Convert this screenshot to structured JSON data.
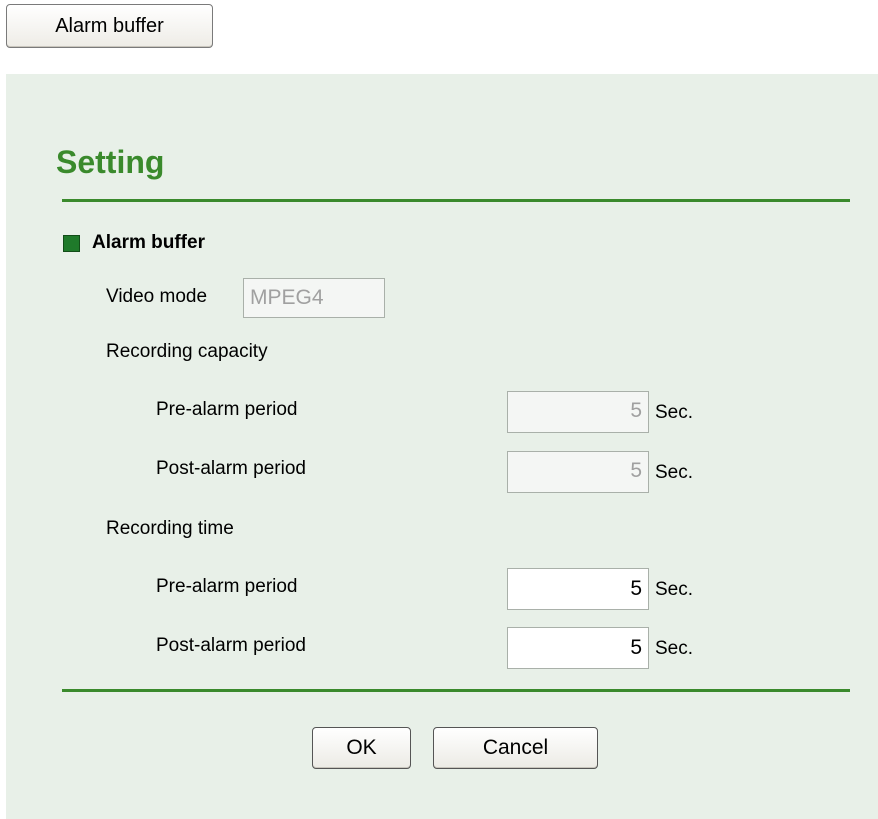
{
  "top_button": {
    "label": "Alarm buffer"
  },
  "page_title": "Setting",
  "section": {
    "label": "Alarm buffer",
    "video_mode": {
      "label": "Video mode",
      "value": "MPEG4"
    },
    "recording_capacity": {
      "label": "Recording capacity",
      "pre_alarm": {
        "label": "Pre-alarm period",
        "value": "5",
        "unit": "Sec."
      },
      "post_alarm": {
        "label": "Post-alarm period",
        "value": "5",
        "unit": "Sec."
      }
    },
    "recording_time": {
      "label": "Recording time",
      "pre_alarm": {
        "label": "Pre-alarm period",
        "value": "5",
        "unit": "Sec."
      },
      "post_alarm": {
        "label": "Post-alarm period",
        "value": "5",
        "unit": "Sec."
      }
    }
  },
  "buttons": {
    "ok": "OK",
    "cancel": "Cancel"
  },
  "colors": {
    "accent_green": "#3a8a2c",
    "panel_background": "#e8f0e8",
    "section_square": "#1f7a2a"
  }
}
